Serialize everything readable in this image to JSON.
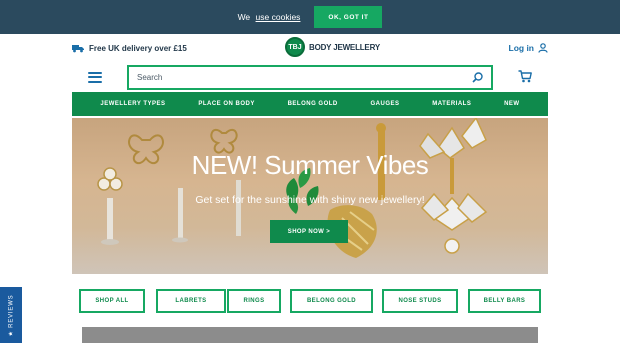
{
  "cookie": {
    "text": "We",
    "link": "use cookies",
    "button": "OK, GOT IT"
  },
  "header": {
    "delivery": "Free UK delivery over £15",
    "logo_badge": "TBJ",
    "logo_text": "BODY JEWELLERY",
    "login": "Log in"
  },
  "search": {
    "placeholder": "Search"
  },
  "nav": {
    "items": [
      "JEWELLERY TYPES",
      "PLACE ON BODY",
      "BELONG GOLD",
      "GAUGES",
      "MATERIALS",
      "NEW"
    ]
  },
  "hero": {
    "title": "NEW! Summer Vibes",
    "subtitle": "Get set for the sunshine with shiny new jewellery!",
    "button": "SHOP NOW >"
  },
  "categories": [
    "SHOP ALL",
    "LABRETS",
    "RINGS",
    "BELONG GOLD",
    "NOSE STUDS",
    "BELLY BARS"
  ],
  "reviews": {
    "label": "★ REVIEWS"
  },
  "colors": {
    "brand_green": "#0f8a4c",
    "accent_blue": "#1a6ea8",
    "cookie_bg": "#2b4a5e"
  }
}
